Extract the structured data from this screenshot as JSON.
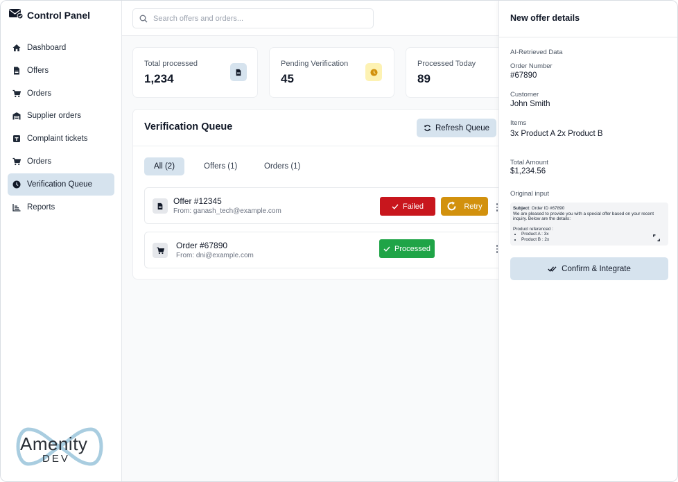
{
  "app": {
    "title": "Control Panel"
  },
  "sidebar": {
    "items": [
      {
        "label": "Dashboard",
        "icon": "home-icon"
      },
      {
        "label": "Offers",
        "icon": "document-icon"
      },
      {
        "label": "Orders",
        "icon": "cart-icon"
      },
      {
        "label": "Supplier orders",
        "icon": "warehouse-icon"
      },
      {
        "label": "Complaint tickets",
        "icon": "ticket-icon"
      },
      {
        "label": "Orders",
        "icon": "cart-icon"
      },
      {
        "label": "Verification Queue",
        "icon": "clock-icon",
        "active": true
      },
      {
        "label": "Reports",
        "icon": "chart-icon"
      }
    ],
    "logo": {
      "word": "Amenity",
      "sub": "DEV"
    }
  },
  "search": {
    "placeholder": "Search offers and orders..."
  },
  "stats": [
    {
      "label": "Total processed",
      "value": "1,234",
      "icon": "document-icon",
      "color": "#d6e3ee"
    },
    {
      "label": "Pending Verification",
      "value": "45",
      "icon": "clock-icon",
      "color": "#fdf2b3"
    },
    {
      "label": "Processed Today",
      "value": "89"
    }
  ],
  "queue": {
    "title": "Verification Queue",
    "refresh_label": "Refresh Queue",
    "tabs": [
      {
        "label": "All (2)",
        "active": true
      },
      {
        "label": "Offers (1)"
      },
      {
        "label": "Orders (1)"
      }
    ],
    "rows": [
      {
        "title": "Offer #12345",
        "from": "From: ganash_tech@example.com",
        "icon": "document-icon",
        "status": "Failed",
        "status_color": "#c8161d",
        "action": "Retry",
        "action_color": "#d2910d"
      },
      {
        "title": "Order #67890",
        "from": "From: dni@example.com",
        "icon": "cart-icon",
        "status": "Processed",
        "status_color": "#1fa447"
      }
    ]
  },
  "detail": {
    "title": "New offer details",
    "section": "AI-Retrieved Data",
    "fields": [
      {
        "label": "Order Number",
        "value": "#67890"
      },
      {
        "label": "Customer",
        "value": "John Smith"
      },
      {
        "label": "Items",
        "value": "3x Product A 2x Product B"
      },
      {
        "label": "Total Amount",
        "value": "$1,234.56"
      }
    ],
    "original_label": "Original input",
    "email": {
      "subject_label": "Subject",
      "subject": ": Order ID #67890",
      "body": "We are pleased to provide you with a special offer based on your recent inquiry. Below are the details:",
      "products_heading": "Product referenced :",
      "products": [
        "Product A :  3x",
        "Product B : 2x"
      ]
    },
    "confirm_label": "Confirm & Integrate"
  }
}
